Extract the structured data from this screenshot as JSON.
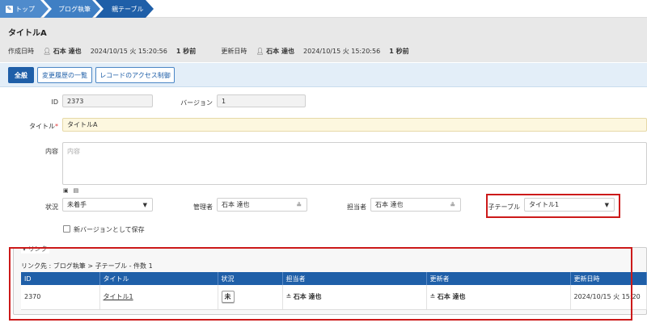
{
  "breadcrumb": {
    "top_label": "トップ",
    "blog_label": "ブログ執筆",
    "parent_label": "親テーブル"
  },
  "record": {
    "title": "タイトルA",
    "created_label": "作成日時",
    "created_user": "石本 達也",
    "created_date": "2024/10/15 火 15:20:56",
    "created_ago": "1 秒前",
    "updated_label": "更新日時",
    "updated_user": "石本 達也",
    "updated_date": "2024/10/15 火 15:20:56",
    "updated_ago": "1 秒前"
  },
  "tabs": {
    "general": "全般",
    "history": "変更履歴の一覧",
    "access": "レコードのアクセス制御"
  },
  "form": {
    "id_label": "ID",
    "id_value": "2373",
    "version_label": "バージョン",
    "version_value": "1",
    "title_label": "タイトル",
    "required_mark": "*",
    "title_value": "タイトルA",
    "content_label": "内容",
    "content_placeholder": "内容",
    "status_label": "状況",
    "status_value": "未着手",
    "manager_label": "管理者",
    "manager_value": "石本 達也",
    "owner_label": "担当者",
    "owner_value": "石本 達也",
    "child_label": "子テーブル",
    "child_value": "タイトル1",
    "new_version_label": "新バージョンとして保存"
  },
  "links": {
    "legend": "リンク",
    "path": "リンク先 : ブログ執筆 > 子テーブル - 件数 1",
    "columns": [
      "ID",
      "タイトル",
      "状況",
      "担当者",
      "更新者",
      "更新日時"
    ],
    "rows": [
      {
        "id": "2370",
        "title": "タイトル1",
        "status": "未",
        "owner": "石本 達也",
        "updater": "石本 達也",
        "updated": "2024/10/15 火 15:20"
      }
    ]
  },
  "colors": {
    "accent": "#1f5fa8",
    "highlight": "#cc1a1a",
    "header_bg": "#e8e8e8"
  },
  "icons": {
    "top": "pencil-icon",
    "user": "user-icon",
    "dropdown": "chevron-down-icon"
  }
}
